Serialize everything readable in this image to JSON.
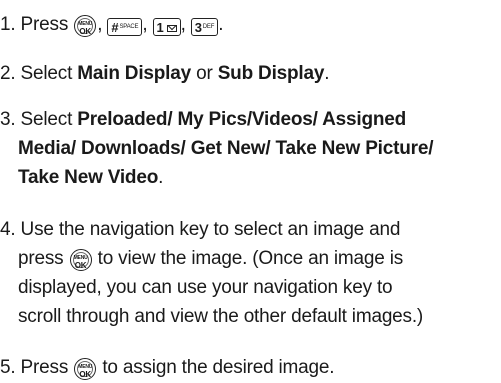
{
  "steps": [
    {
      "number": "1.",
      "parts": {
        "press": "Press",
        "sep1": ",",
        "sep2": ",",
        "sep3": ",",
        "end": "."
      }
    },
    {
      "number": "2.",
      "parts": {
        "select": "Select",
        "main_display": "Main Display",
        "or": "or",
        "sub_display": "Sub Display",
        "end": "."
      }
    },
    {
      "number": "3.",
      "parts": {
        "select": "Select",
        "line1_bold": "Preloaded/ My Pics/Videos/ Assigned",
        "line2_bold": "Media/ Downloads/ Get New/ Take New Picture/",
        "line3_bold": "Take New Video",
        "end": "."
      }
    },
    {
      "number": "4.",
      "lines": [
        "Use the navigation key to select an image and",
        "to view the image. (Once an image is",
        "displayed, you can use your navigation key to",
        "scroll through and view the other default images.)"
      ],
      "press": "press"
    },
    {
      "number": "5.",
      "parts": {
        "press": "Press",
        "rest": "to assign the desired image."
      }
    }
  ],
  "keys": {
    "ok_top": "MENU",
    "ok_bottom": "OK",
    "hash_main": "#",
    "hash_sub": "SPACE",
    "one_main": "1",
    "three_main": "3",
    "three_sub": "DEF"
  }
}
